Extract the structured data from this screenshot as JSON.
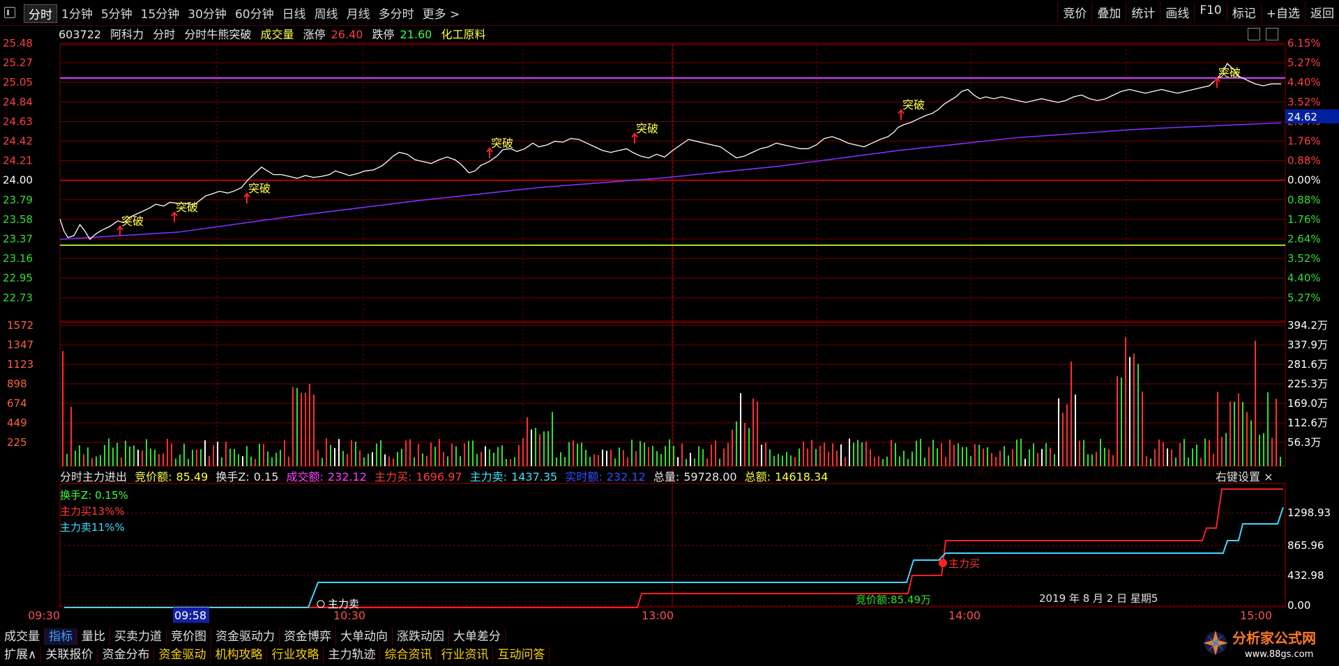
{
  "toolbar": {
    "tabs": [
      "分时",
      "1分钟",
      "5分钟",
      "15分钟",
      "30分钟",
      "60分钟",
      "日线",
      "周线",
      "月线",
      "多分时",
      "更多 >"
    ],
    "right": [
      "竞价",
      "叠加",
      "统计",
      "画线",
      "F10",
      "标记",
      "+自选",
      "返回"
    ]
  },
  "info": {
    "code": "603722",
    "name": "阿科力",
    "mode": "分时",
    "indicator": "分时牛熊突破",
    "volume_label": "成交量",
    "limit_up_label": "涨停",
    "limit_up": "26.40",
    "limit_down_label": "跌停",
    "limit_down": "21.60",
    "sector": "化工原料"
  },
  "price_axis": {
    "left": [
      "25.48",
      "25.27",
      "25.05",
      "24.84",
      "24.63",
      "24.42",
      "24.21",
      "24.00",
      "23.79",
      "23.58",
      "23.37",
      "23.16",
      "22.95",
      "22.73"
    ],
    "right": [
      "6.15%",
      "5.27%",
      "4.40%",
      "3.52%",
      "2.64%",
      "1.76%",
      "0.88%",
      "0.00%",
      "0.88%",
      "1.76%",
      "2.64%",
      "3.52%",
      "4.40%",
      "5.27%"
    ],
    "current_avg_label": "24.62",
    "prev_close": 24.0
  },
  "volume_axis": {
    "left": [
      "1572",
      "1347",
      "1123",
      "898",
      "674",
      "449",
      "225"
    ],
    "right": [
      "394.2万",
      "337.9万",
      "281.6万",
      "225.3万",
      "169.0万",
      "112.6万",
      "56.3万"
    ]
  },
  "signal_label": "突破",
  "indicator_panel": {
    "title": "分时主力进出",
    "bid_amount_label": "竞价额:",
    "bid_amount": "85.49",
    "turnover_label": "换手Z:",
    "turnover": "0.15",
    "volume_label": "成交额:",
    "volume": "232.12",
    "main_buy_label": "主力买:",
    "main_buy": "1696.97",
    "main_sell_label": "主力卖:",
    "main_sell": "1437.35",
    "realtime_label": "实时额:",
    "realtime": "232.12",
    "total_vol_label": "总量:",
    "total_vol": "59728.00",
    "total_amt_label": "总额:",
    "total_amt": "14618.34",
    "legend": [
      "换手Z: 0.15%",
      "主力买13%%",
      "主力卖11%%"
    ],
    "right_key": "右键设置",
    "axis_right": [
      "1298.93",
      "865.96",
      "432.98",
      "0.00"
    ],
    "annot_buy": "主力买",
    "annot_sell": "主力卖",
    "annot_bid": "竞价额:85.49万",
    "date": "2019 年 8 月 2 日 星期5"
  },
  "time_axis": [
    "09:30",
    "09:58",
    "10:30",
    "13:00",
    "14:00",
    "15:00"
  ],
  "bottom_tabs_1": [
    "成交量",
    "指标",
    "量比",
    "买卖力道",
    "竞价图",
    "资金驱动力",
    "资金博弈",
    "大单动向",
    "涨跌动因",
    "大单差分"
  ],
  "bottom_tabs_2": [
    "扩展∧",
    "关联报价",
    "资金分布",
    "资金驱动",
    "机构攻略",
    "行业攻略",
    "主力轨迹",
    "综合资讯",
    "行业资讯",
    "互动问答"
  ],
  "logo": {
    "title": "分析家公式网",
    "url": "www.88gs.com"
  },
  "chart_data": {
    "type": "line",
    "title": "分时",
    "price_series": [
      [
        0,
        23.58
      ],
      [
        4,
        23.45
      ],
      [
        8,
        23.38
      ],
      [
        14,
        23.4
      ],
      [
        20,
        23.52
      ],
      [
        25,
        23.45
      ],
      [
        30,
        23.36
      ],
      [
        36,
        23.42
      ],
      [
        42,
        23.46
      ],
      [
        50,
        23.5
      ],
      [
        58,
        23.56
      ],
      [
        64,
        23.54
      ],
      [
        70,
        23.6
      ],
      [
        76,
        23.63
      ],
      [
        82,
        23.66
      ],
      [
        90,
        23.7
      ],
      [
        96,
        23.74
      ],
      [
        104,
        23.72
      ],
      [
        110,
        23.76
      ],
      [
        118,
        23.75
      ],
      [
        126,
        23.75
      ],
      [
        134,
        23.73
      ],
      [
        140,
        23.78
      ],
      [
        146,
        23.83
      ],
      [
        152,
        23.85
      ],
      [
        160,
        23.88
      ],
      [
        168,
        23.86
      ],
      [
        174,
        23.88
      ],
      [
        182,
        23.92
      ],
      [
        188,
        24.0
      ],
      [
        196,
        24.08
      ],
      [
        202,
        24.14
      ],
      [
        208,
        24.1
      ],
      [
        214,
        24.06
      ],
      [
        222,
        24.06
      ],
      [
        230,
        24.04
      ],
      [
        238,
        24.02
      ],
      [
        246,
        24.05
      ],
      [
        254,
        24.03
      ],
      [
        262,
        24.04
      ],
      [
        270,
        24.06
      ],
      [
        276,
        24.1
      ],
      [
        282,
        24.08
      ],
      [
        290,
        24.05
      ],
      [
        298,
        24.07
      ],
      [
        306,
        24.1
      ],
      [
        314,
        24.11
      ],
      [
        322,
        24.15
      ],
      [
        328,
        24.2
      ],
      [
        334,
        24.26
      ],
      [
        340,
        24.3
      ],
      [
        348,
        24.28
      ],
      [
        356,
        24.22
      ],
      [
        364,
        24.2
      ],
      [
        372,
        24.18
      ],
      [
        380,
        24.22
      ],
      [
        388,
        24.25
      ],
      [
        396,
        24.22
      ],
      [
        402,
        24.17
      ],
      [
        410,
        24.08
      ],
      [
        416,
        24.1
      ],
      [
        422,
        24.16
      ],
      [
        430,
        24.2
      ],
      [
        438,
        24.26
      ],
      [
        444,
        24.33
      ],
      [
        452,
        24.34
      ],
      [
        458,
        24.31
      ],
      [
        466,
        24.34
      ],
      [
        474,
        24.4
      ],
      [
        480,
        24.36
      ],
      [
        488,
        24.38
      ],
      [
        496,
        24.42
      ],
      [
        504,
        24.41
      ],
      [
        512,
        24.45
      ],
      [
        520,
        24.44
      ],
      [
        528,
        24.4
      ],
      [
        536,
        24.36
      ],
      [
        544,
        24.32
      ],
      [
        552,
        24.3
      ],
      [
        560,
        24.32
      ],
      [
        568,
        24.34
      ],
      [
        574,
        24.3
      ],
      [
        582,
        24.26
      ],
      [
        590,
        24.24
      ],
      [
        598,
        24.28
      ],
      [
        606,
        24.25
      ],
      [
        614,
        24.32
      ],
      [
        622,
        24.38
      ],
      [
        630,
        24.44
      ],
      [
        638,
        24.42
      ],
      [
        646,
        24.4
      ],
      [
        654,
        24.38
      ],
      [
        662,
        24.36
      ],
      [
        670,
        24.3
      ],
      [
        678,
        24.24
      ],
      [
        686,
        24.26
      ],
      [
        694,
        24.3
      ],
      [
        702,
        24.34
      ],
      [
        710,
        24.36
      ],
      [
        718,
        24.4
      ],
      [
        726,
        24.38
      ],
      [
        734,
        24.36
      ],
      [
        742,
        24.34
      ],
      [
        750,
        24.34
      ],
      [
        758,
        24.38
      ],
      [
        766,
        24.45
      ],
      [
        774,
        24.47
      ],
      [
        782,
        24.44
      ],
      [
        790,
        24.4
      ],
      [
        798,
        24.38
      ],
      [
        806,
        24.36
      ],
      [
        814,
        24.4
      ],
      [
        822,
        24.44
      ],
      [
        830,
        24.47
      ],
      [
        836,
        24.52
      ],
      [
        840,
        24.57
      ],
      [
        846,
        24.6
      ],
      [
        852,
        24.62
      ],
      [
        860,
        24.66
      ],
      [
        868,
        24.7
      ],
      [
        874,
        24.72
      ],
      [
        880,
        24.76
      ],
      [
        886,
        24.82
      ],
      [
        892,
        24.86
      ],
      [
        898,
        24.9
      ],
      [
        904,
        24.96
      ],
      [
        910,
        24.98
      ],
      [
        916,
        24.92
      ],
      [
        922,
        24.88
      ],
      [
        928,
        24.9
      ],
      [
        936,
        24.88
      ],
      [
        944,
        24.9
      ],
      [
        952,
        24.88
      ],
      [
        960,
        24.86
      ],
      [
        968,
        24.84
      ],
      [
        976,
        24.86
      ],
      [
        984,
        24.88
      ],
      [
        992,
        24.86
      ],
      [
        1000,
        24.84
      ],
      [
        1008,
        24.86
      ],
      [
        1016,
        24.9
      ],
      [
        1024,
        24.92
      ],
      [
        1032,
        24.88
      ],
      [
        1040,
        24.86
      ],
      [
        1048,
        24.88
      ],
      [
        1056,
        24.92
      ],
      [
        1064,
        24.96
      ],
      [
        1072,
        24.98
      ],
      [
        1080,
        24.96
      ],
      [
        1088,
        24.94
      ],
      [
        1096,
        24.96
      ],
      [
        1104,
        24.98
      ],
      [
        1112,
        24.96
      ],
      [
        1120,
        24.94
      ],
      [
        1128,
        24.96
      ],
      [
        1136,
        24.98
      ],
      [
        1144,
        25.0
      ],
      [
        1152,
        25.02
      ],
      [
        1160,
        25.1
      ],
      [
        1166,
        25.18
      ],
      [
        1170,
        25.26
      ],
      [
        1176,
        25.2
      ],
      [
        1182,
        25.12
      ],
      [
        1190,
        25.08
      ],
      [
        1198,
        25.04
      ],
      [
        1206,
        25.02
      ],
      [
        1214,
        25.04
      ],
      [
        1224,
        25.04
      ]
    ],
    "avg_series": [
      [
        0,
        23.36
      ],
      [
        120,
        23.44
      ],
      [
        240,
        23.62
      ],
      [
        360,
        23.78
      ],
      [
        480,
        23.92
      ],
      [
        600,
        24.02
      ],
      [
        720,
        24.15
      ],
      [
        840,
        24.32
      ],
      [
        960,
        24.46
      ],
      [
        1080,
        24.55
      ],
      [
        1224,
        24.62
      ]
    ],
    "price_range": [
      22.62,
      25.59
    ],
    "time_labels": [
      "09:30",
      "10:30",
      "13:00",
      "14:00",
      "15:00"
    ]
  }
}
